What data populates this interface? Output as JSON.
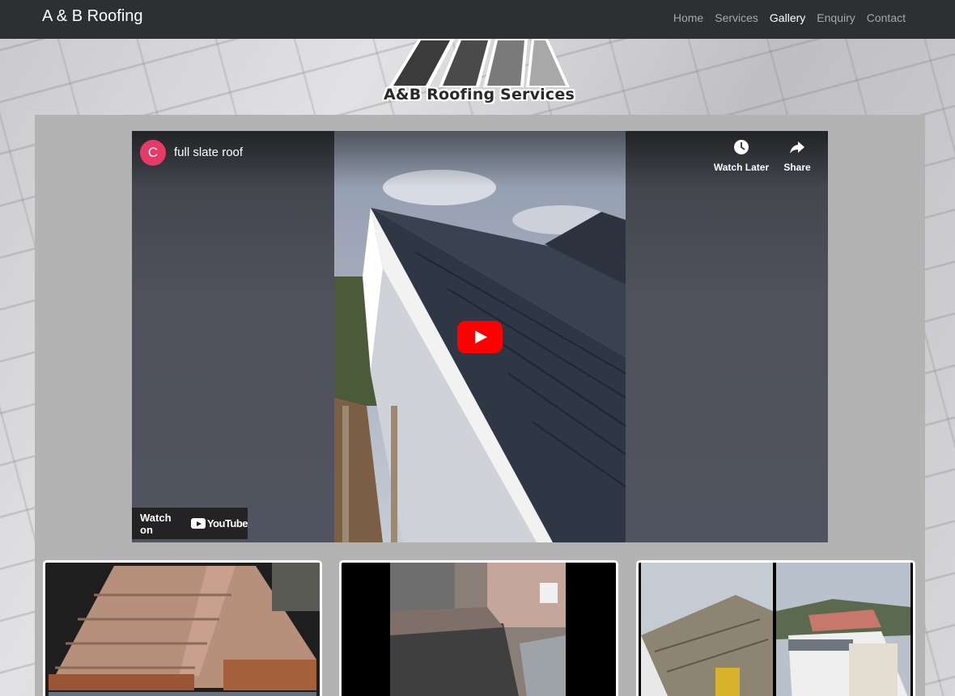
{
  "navbar": {
    "brand": "A & B Roofing",
    "links": [
      {
        "label": "Home",
        "active": false
      },
      {
        "label": "Services",
        "active": false
      },
      {
        "label": "Gallery",
        "active": true
      },
      {
        "label": "Enquiry",
        "active": false
      },
      {
        "label": "Contact",
        "active": false
      }
    ]
  },
  "logo": {
    "text": "A&B Roofing Services"
  },
  "video": {
    "channel_initial": "C",
    "title": "full slate roof",
    "watch_later_label": "Watch Later",
    "share_label": "Share",
    "watch_on_label": "Watch on",
    "youtube_label": "YouTube"
  },
  "colors": {
    "navbar_bg": "#2c3033",
    "panel_bg": "#b3b3b3",
    "avatar": "#e63b67",
    "play_button": "#ff0000"
  }
}
